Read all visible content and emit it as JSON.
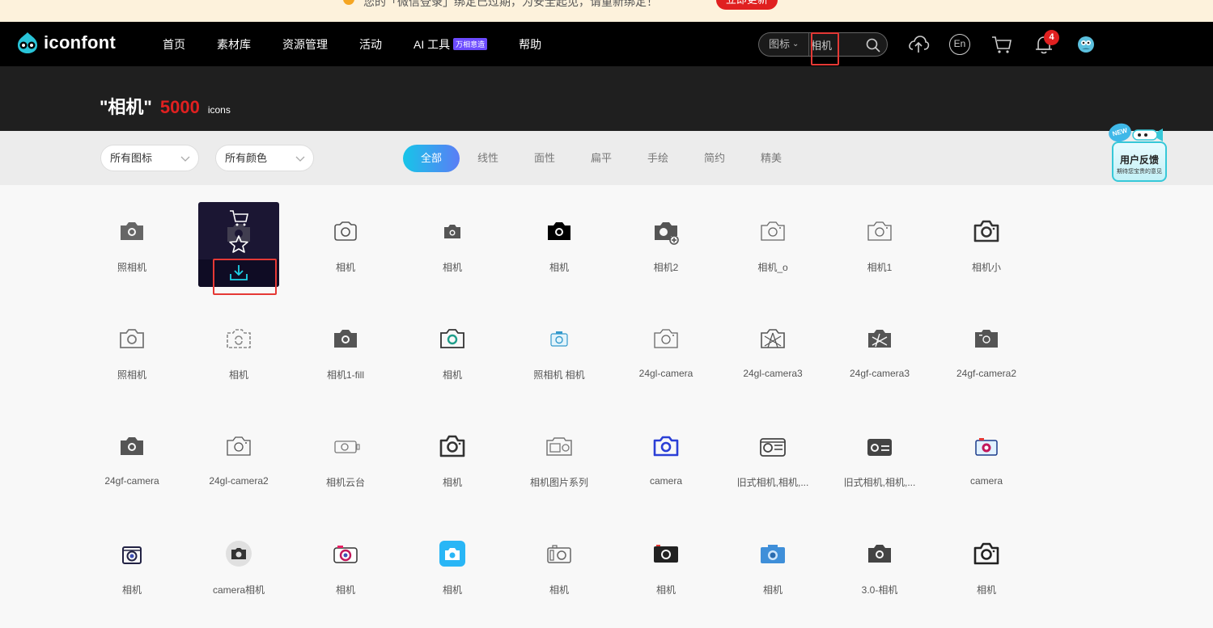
{
  "banner": {
    "text": "您的「微信登录」绑定已过期，为安全起见，请重新绑定！",
    "button": "立即更新"
  },
  "nav": {
    "logo_text": "iconfont",
    "items": [
      "首页",
      "素材库",
      "资源管理",
      "活动",
      "AI 工具",
      "帮助"
    ],
    "ai_badge": "万相意造",
    "search_type": "图标",
    "search_value": "相机",
    "notification_count": "4",
    "lang_label": "En"
  },
  "hero": {
    "query": "\"相机\"",
    "count": "5000",
    "unit": "icons"
  },
  "filters": {
    "icon_select": "所有图标",
    "color_select": "所有颜色",
    "tabs": [
      "全部",
      "线性",
      "面性",
      "扁平",
      "手绘",
      "简约",
      "精美"
    ],
    "active_tab": "全部"
  },
  "feedback": {
    "badge": "NEW",
    "title": "用户反馈",
    "subtitle": "期待您宝贵的意见"
  },
  "icons": [
    {
      "name": "照相机",
      "style": "fill",
      "color": "#666666"
    },
    {
      "name": "",
      "style": "fill",
      "color": "#444444"
    },
    {
      "name": "相机",
      "style": "round-line",
      "color": "#555555"
    },
    {
      "name": "相机",
      "style": "fill-small",
      "color": "#555555"
    },
    {
      "name": "相机",
      "style": "fill",
      "color": "#000000"
    },
    {
      "name": "相机2",
      "style": "fill-plus",
      "color": "#555555"
    },
    {
      "name": "相机_o",
      "style": "thin-line",
      "color": "#666666"
    },
    {
      "name": "相机1",
      "style": "thin-line",
      "color": "#666666"
    },
    {
      "name": "相机小",
      "style": "bold-line",
      "color": "#333333"
    },
    {
      "name": "照相机",
      "style": "line",
      "color": "#777777"
    },
    {
      "name": "相机",
      "style": "dashed-line",
      "color": "#888888"
    },
    {
      "name": "相机1-fill",
      "style": "fill",
      "color": "#555555"
    },
    {
      "name": "相机",
      "style": "line-teal",
      "color": "#1f9e8a"
    },
    {
      "name": "照相机 相机",
      "style": "blue-small",
      "color": "#3399cc"
    },
    {
      "name": "24gl-camera",
      "style": "thin-line",
      "color": "#666666"
    },
    {
      "name": "24gl-camera3",
      "style": "aperture-line",
      "color": "#555555"
    },
    {
      "name": "24gf-camera3",
      "style": "aperture-fill",
      "color": "#555555"
    },
    {
      "name": "24gf-camera2",
      "style": "fill-box",
      "color": "#555555"
    },
    {
      "name": "24gf-camera",
      "style": "fill",
      "color": "#555555"
    },
    {
      "name": "24gl-camera2",
      "style": "thin-line",
      "color": "#555555"
    },
    {
      "name": "相机云台",
      "style": "gimbal",
      "color": "#777777"
    },
    {
      "name": "相机",
      "style": "bold-line",
      "color": "#333333"
    },
    {
      "name": "相机图片系列",
      "style": "retro-line",
      "color": "#777777"
    },
    {
      "name": "camera",
      "style": "line-blue",
      "color": "#2b3fd6"
    },
    {
      "name": "旧式相机,相机,...",
      "style": "old-line",
      "color": "#444444"
    },
    {
      "name": "旧式相机,相机,...",
      "style": "old-fill",
      "color": "#444444"
    },
    {
      "name": "camera",
      "style": "colorful",
      "color": "#c2185b"
    },
    {
      "name": "相机",
      "style": "box-lens",
      "color": "#222244"
    },
    {
      "name": "camera相机",
      "style": "circle-gray",
      "color": "#333333"
    },
    {
      "name": "相机",
      "style": "colorful-pink",
      "color": "#c2185b"
    },
    {
      "name": "相机",
      "style": "cyan-tile",
      "color": "#29b6f6"
    },
    {
      "name": "相机",
      "style": "sketch",
      "color": "#666666"
    },
    {
      "name": "相机",
      "style": "black-fill",
      "color": "#222222"
    },
    {
      "name": "相机",
      "style": "blue-fill",
      "color": "#3f8fd9"
    },
    {
      "name": "3.0-相机",
      "style": "fill",
      "color": "#444444"
    },
    {
      "name": "相机",
      "style": "bold-line",
      "color": "#222222"
    }
  ]
}
